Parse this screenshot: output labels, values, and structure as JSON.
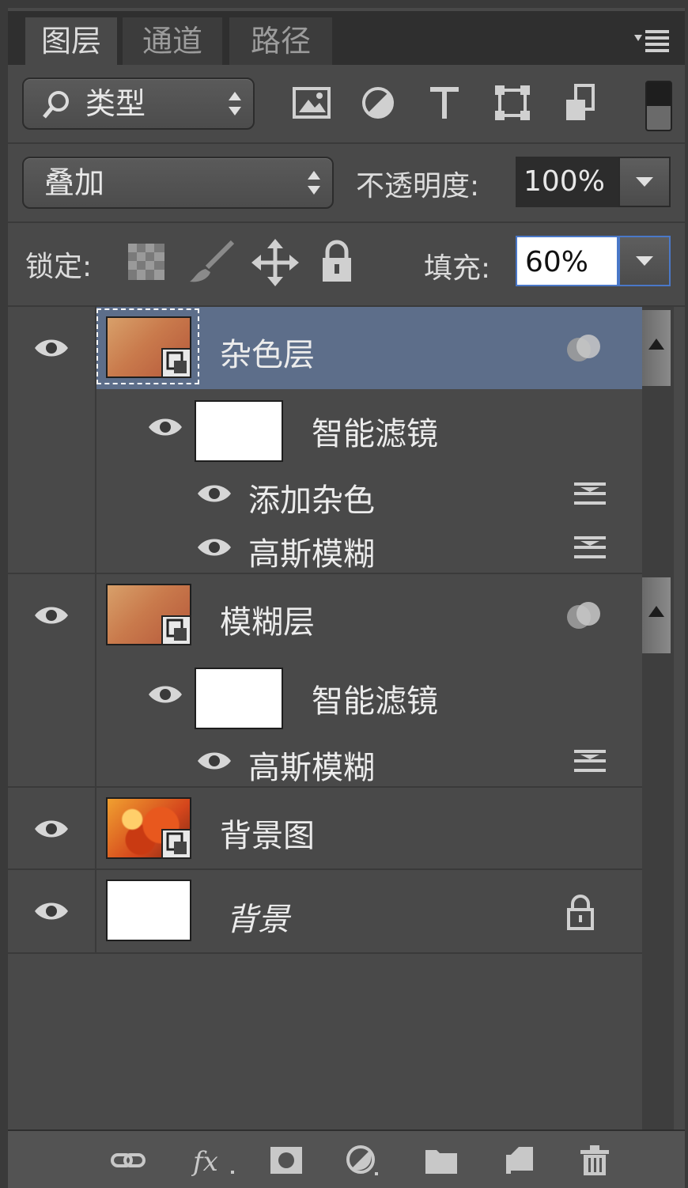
{
  "tabs": [
    {
      "label": "图层",
      "active": true
    },
    {
      "label": "通道",
      "active": false
    },
    {
      "label": "路径",
      "active": false
    }
  ],
  "filter": {
    "kind_label": "类型",
    "icons": [
      "image-filter-icon",
      "adjustment-filter-icon",
      "type-filter-icon",
      "shape-filter-icon",
      "smart-object-filter-icon",
      "filter-toggle-icon"
    ]
  },
  "blend": {
    "mode": "叠加",
    "opacity_label": "不透明度:",
    "opacity_value": "100%"
  },
  "lock": {
    "label": "锁定:",
    "fill_label": "填充:",
    "fill_value": "60%"
  },
  "layers": [
    {
      "name": "杂色层",
      "selected": true,
      "smart_filters_label": "智能滤镜",
      "filters": [
        "添加杂色",
        "高斯模糊"
      ]
    },
    {
      "name": "模糊层",
      "selected": false,
      "smart_filters_label": "智能滤镜",
      "filters": [
        "高斯模糊"
      ]
    },
    {
      "name": "背景图",
      "selected": false
    },
    {
      "name": "背景",
      "selected": false,
      "locked": true
    }
  ],
  "bottom_icons": [
    "link-layers-icon",
    "fx-icon",
    "add-mask-icon",
    "new-adjustment-icon",
    "new-group-icon",
    "new-layer-icon",
    "delete-layer-icon"
  ],
  "colors": {
    "panel": "#494949",
    "selected": "#5d6e8a",
    "dark": "#2f2f2f"
  }
}
